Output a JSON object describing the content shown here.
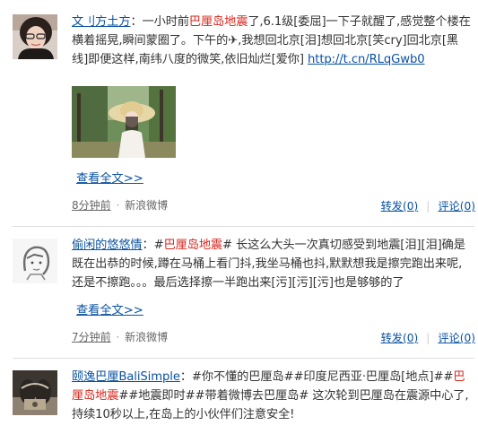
{
  "posts": [
    {
      "user": "文刂方土方",
      "text_parts": [
        {
          "t": "：一小时前",
          "c": "n"
        },
        {
          "t": "巴厘岛地震",
          "c": "h"
        },
        {
          "t": "了,6.1级[委屈]一下子就醒了,感觉整个楼在横着摇晃,瞬间蒙圈了。下午的✈,我想回北京[泪]想回北京[笑cry]回北京[黑线]即便这样,南纬八度的微笑,依旧灿烂[爱你] ",
          "c": "n"
        },
        {
          "t": "http://t.cn/RLqGwb0",
          "c": "l"
        }
      ],
      "more": "查看全文>>",
      "time": "8分钟前",
      "sep": "·",
      "source": "新浪微博",
      "repost": "转发(0)",
      "divider": "|",
      "comment": "评论(0)"
    },
    {
      "user": "偷闲的悠悠情",
      "text_parts": [
        {
          "t": "：#",
          "c": "n"
        },
        {
          "t": "巴厘岛地震",
          "c": "h"
        },
        {
          "t": "# 长这么大头一次真切感受到地震[泪][泪]确是既在出恭的时候,蹲在马桶上看门抖,我坐马桶也抖,默默想我是擦完跑出来呢,还是不擦跑。。。最后选择擦一半跑出来[污][污][污]也是够够的了",
          "c": "n"
        }
      ],
      "more": "查看全文>>",
      "time": "7分钟前",
      "sep": "·",
      "source": "新浪微博",
      "repost": "转发(0)",
      "divider": "|",
      "comment": "评论(0)"
    },
    {
      "user": "颐逸巴厘BaliSimple",
      "text_parts": [
        {
          "t": "：#你不懂的巴厘岛##印度尼西亚·巴厘岛[地点]##",
          "c": "n"
        },
        {
          "t": "巴厘岛地震",
          "c": "h"
        },
        {
          "t": "##地震即时##带着微博去巴厘岛# 这次轮到巴厘岛在震源中心了,持续10秒以上,在岛上的小伙伴们注意安全!",
          "c": "n"
        }
      ]
    }
  ]
}
